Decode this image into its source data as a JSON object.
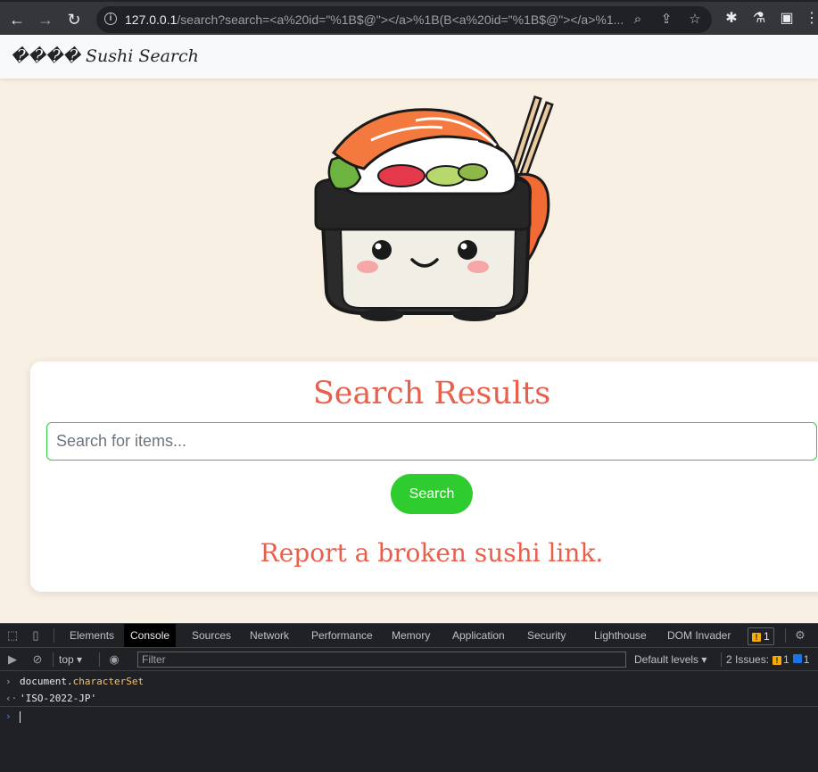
{
  "browser": {
    "url_host": "127.0.0.1",
    "url_rest": "/search?search=<a%20id=\"%1B$@\"></a>%1B(B<a%20id=\"%1B$@\"></a>%1..."
  },
  "site": {
    "brand": "���� Sushi Search"
  },
  "card": {
    "title": "Search Results",
    "search_placeholder": "Search for items...",
    "search_button": "Search",
    "report_link": "Report a broken sushi link."
  },
  "devtools": {
    "tabs": [
      "Elements",
      "Console",
      "Sources",
      "Network",
      "Performance",
      "Memory",
      "Application",
      "Security",
      "Lighthouse",
      "DOM Invader"
    ],
    "active_tab": "Console",
    "issue_badge_count": "1",
    "context": "top",
    "filter_placeholder": "Filter",
    "levels": "Default levels",
    "issues_label": "2 Issues:",
    "issues_warn": "1",
    "issues_info": "1",
    "console": {
      "input_object": "document",
      "input_prop": "characterSet",
      "output": "'ISO-2022-JP'"
    }
  },
  "colors": {
    "page_bg": "#f8f0e3",
    "accent": "#e8604c",
    "button": "#2ecc2e",
    "devtools_bg": "#202124"
  }
}
